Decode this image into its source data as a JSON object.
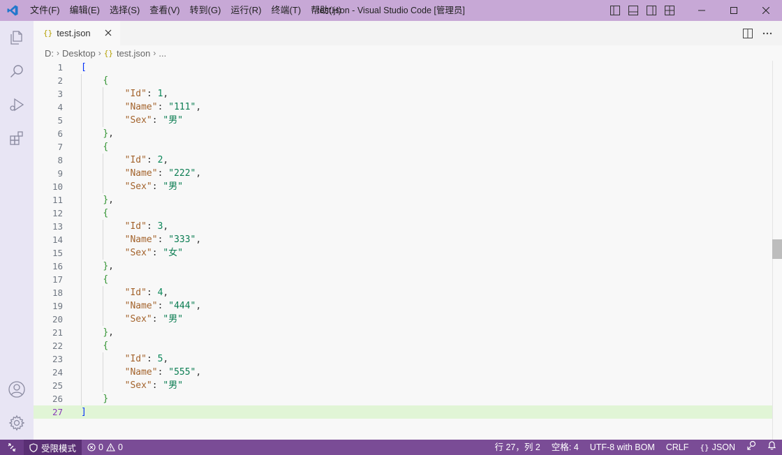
{
  "window": {
    "title": "test.json - Visual Studio Code [管理员]",
    "menu": [
      "文件(F)",
      "编辑(E)",
      "选择(S)",
      "查看(V)",
      "转到(G)",
      "运行(R)",
      "终端(T)",
      "帮助(H)"
    ]
  },
  "activity_bar": {
    "top_icons": [
      "files-icon",
      "search-icon",
      "run-debug-icon",
      "extensions-icon"
    ],
    "bottom_icons": [
      "account-icon",
      "settings-gear-icon"
    ]
  },
  "tab": {
    "icon_glyph": "{}",
    "label": "test.json"
  },
  "breadcrumb": {
    "items": [
      "D:",
      "Desktop",
      "test.json",
      "..."
    ]
  },
  "editor": {
    "current_line": 27,
    "line_numbers": [
      "1",
      "2",
      "3",
      "4",
      "5",
      "6",
      "7",
      "8",
      "9",
      "10",
      "11",
      "12",
      "13",
      "14",
      "15",
      "16",
      "17",
      "18",
      "19",
      "20",
      "21",
      "22",
      "23",
      "24",
      "25",
      "26",
      "27"
    ],
    "records": [
      {
        "id": 1,
        "name": "111",
        "sex": "男"
      },
      {
        "id": 2,
        "name": "222",
        "sex": "男"
      },
      {
        "id": 3,
        "name": "333",
        "sex": "女"
      },
      {
        "id": 4,
        "name": "444",
        "sex": "男"
      },
      {
        "id": 5,
        "name": "555",
        "sex": "男"
      }
    ],
    "keys": {
      "id": "\"Id\"",
      "name": "\"Name\"",
      "sex": "\"Sex\""
    }
  },
  "status_bar": {
    "restricted_mode": "受限模式",
    "errors": "0",
    "warnings": "0",
    "cursor_position": "行 27，列 2",
    "indentation": "空格: 4",
    "encoding": "UTF-8 with BOM",
    "line_ending": "CRLF",
    "language_glyph": "{}",
    "language": "JSON"
  },
  "colors": {
    "title_bar": "#c7a8d6",
    "status_bar": "#7a4c96",
    "activity_bar": "#e8e5f4",
    "current_line": "#e1f5d6"
  }
}
